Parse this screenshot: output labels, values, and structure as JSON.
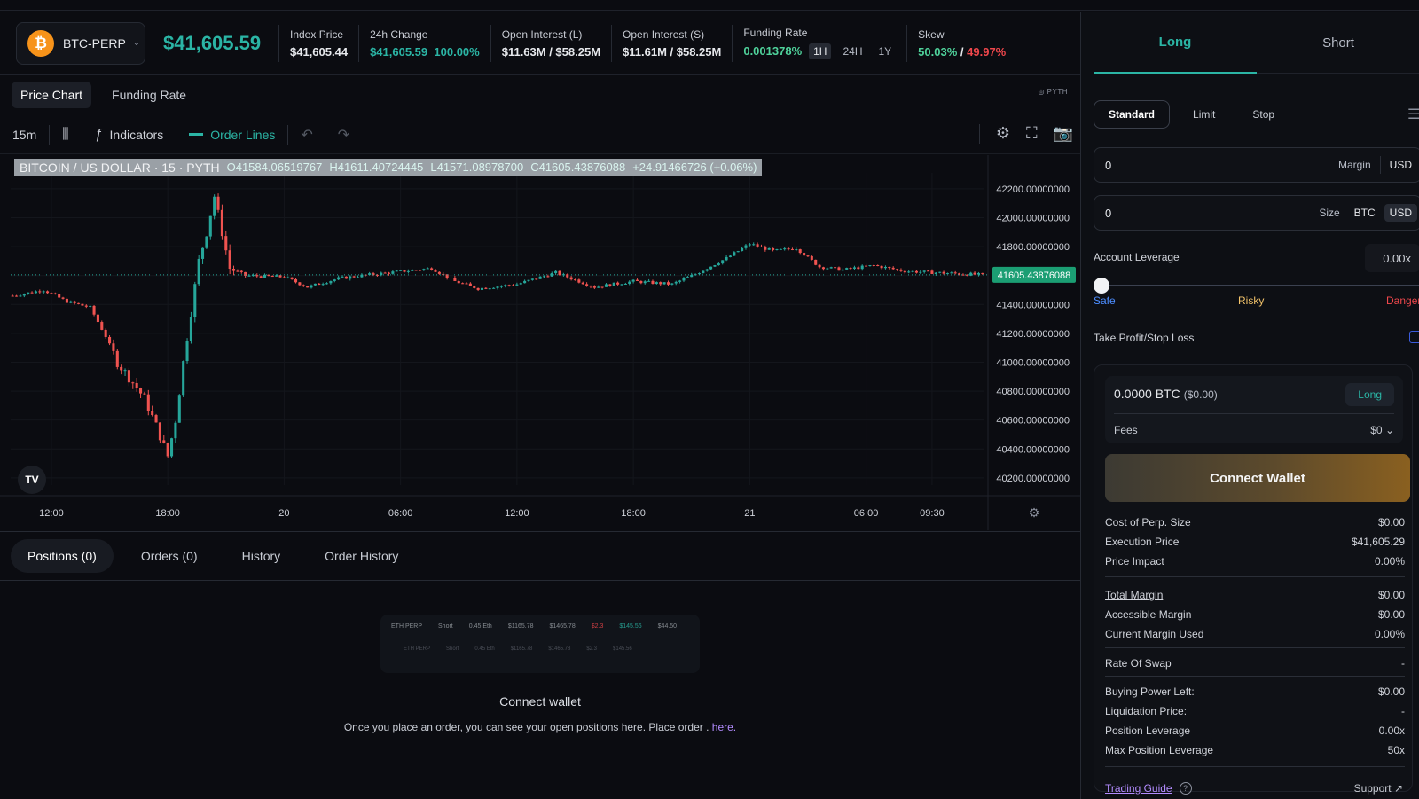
{
  "header": {
    "market": "BTC-PERP",
    "market_icon": "bitcoin-icon",
    "last_price": "$41,605.59",
    "stats": {
      "index_price_label": "Index Price",
      "index_price": "$41,605.44",
      "change_label": "24h Change",
      "change_value": "$41,605.59",
      "change_pct": "100.00%",
      "oi_long_label": "Open Interest (L)",
      "oi_long": "$11.63M / $58.25M",
      "oi_short_label": "Open Interest (S)",
      "oi_short": "$11.61M / $58.25M",
      "funding_label": "Funding Rate",
      "funding_value": "0.001378%",
      "funding_tf": [
        "1H",
        "24H",
        "1Y"
      ],
      "skew_label": "Skew",
      "skew_long": "50.03%",
      "skew_sep": "/",
      "skew_short": "49.97%"
    }
  },
  "chart_tabs": [
    "Price Chart",
    "Funding Rate"
  ],
  "toolbar": {
    "interval": "15m",
    "indicators": "Indicators",
    "order_lines": "Order Lines"
  },
  "chart_data": {
    "type": "candlestick",
    "legend_symbol": "BITCOIN / US DOLLAR · 15 · PYTH",
    "legend_o": "O41584.06519767",
    "legend_h": "H41611.40724445",
    "legend_l": "L41571.08978700",
    "legend_c": "C41605.43876088",
    "legend_chg": "+24.91466726 (+0.06%)",
    "y_ticks": [
      "42200.00000000",
      "42000.00000000",
      "41800.00000000",
      "41600.00000000",
      "41400.00000000",
      "41200.00000000",
      "41000.00000000",
      "40800.00000000",
      "40600.00000000",
      "40400.00000000",
      "40200.00000000"
    ],
    "ylim": [
      40150,
      42310
    ],
    "x_ticks": [
      "12:00",
      "18:00",
      "20",
      "06:00",
      "12:00",
      "18:00",
      "21",
      "06:00",
      "09:30"
    ],
    "last_price_label": "41605.43876088",
    "last_price": 41605.44,
    "colors": {
      "up": "#26a69a",
      "down": "#ef5350"
    },
    "close_path": [
      [
        0,
        41460
      ],
      [
        8,
        41500
      ],
      [
        14,
        41420
      ],
      [
        20,
        41380
      ],
      [
        24,
        41180
      ],
      [
        27,
        41000
      ],
      [
        31,
        40860
      ],
      [
        34,
        40750
      ],
      [
        37,
        40560
      ],
      [
        40,
        40350
      ],
      [
        42,
        40600
      ],
      [
        44,
        41000
      ],
      [
        46,
        41350
      ],
      [
        48,
        41700
      ],
      [
        50,
        41900
      ],
      [
        52,
        42150
      ],
      [
        54,
        41900
      ],
      [
        56,
        41650
      ],
      [
        60,
        41600
      ],
      [
        70,
        41590
      ],
      [
        76,
        41520
      ],
      [
        84,
        41580
      ],
      [
        90,
        41600
      ],
      [
        108,
        41650
      ],
      [
        114,
        41560
      ],
      [
        120,
        41510
      ],
      [
        130,
        41540
      ],
      [
        140,
        41620
      ],
      [
        150,
        41520
      ],
      [
        160,
        41560
      ],
      [
        170,
        41540
      ],
      [
        176,
        41610
      ],
      [
        184,
        41720
      ],
      [
        190,
        41820
      ],
      [
        196,
        41770
      ],
      [
        202,
        41790
      ],
      [
        208,
        41660
      ],
      [
        214,
        41640
      ],
      [
        222,
        41670
      ],
      [
        230,
        41630
      ],
      [
        238,
        41620
      ],
      [
        250,
        41605
      ]
    ],
    "time_ticks_at_candle": [
      10,
      40,
      70,
      100,
      130,
      160,
      190,
      220,
      237
    ]
  },
  "bottom_tabs": [
    "Positions  (0)",
    "Orders  (0)",
    "History",
    "Order History"
  ],
  "empty_state": {
    "preview_row": [
      "ETH PERP",
      "Short",
      "0.45 Eth",
      "$1165.78",
      "$1465.78",
      "$2.3",
      "$145.56",
      "$44.50"
    ],
    "preview_row2": [
      "ETH PERP",
      "Short",
      "0.45 Eth",
      "$1165.78",
      "$1465.78",
      "$2.3",
      "$145.56"
    ],
    "title": "Connect wallet",
    "subtitle": "Once you place an order, you can see your open positions here. Place order .",
    "link": "here."
  },
  "side": {
    "tabs": [
      "Long",
      "Short"
    ],
    "order_types": [
      "Standard",
      "Limit",
      "Stop"
    ],
    "margin_value": "0",
    "margin_label": "Margin",
    "margin_unit": "USD",
    "size_value": "0",
    "size_label": "Size",
    "size_units": [
      "BTC",
      "USD"
    ],
    "leverage_label": "Account Leverage",
    "leverage_value": "0.00x",
    "risk_labels": [
      "Safe",
      "Risky",
      "Danger"
    ],
    "tpsl_label": "Take Profit/Stop Loss",
    "summary_size": "0.0000 BTC",
    "summary_usd": "($0.00)",
    "summary_side": "Long",
    "fees_label": "Fees",
    "fees_value": "$0",
    "connect_button": "Connect Wallet",
    "rows1": [
      {
        "k": "Cost of Perp. Size",
        "v": "$0.00"
      },
      {
        "k": "Execution Price",
        "v": "$41,605.29"
      },
      {
        "k": "Price Impact",
        "v": "0.00%"
      }
    ],
    "rows2": [
      {
        "k": "Total Margin",
        "v": "$0.00"
      },
      {
        "k": "Accessible Margin",
        "v": "$0.00"
      },
      {
        "k": "Current Margin Used",
        "v": "0.00%"
      }
    ],
    "rows3": [
      {
        "k": "Rate Of Swap",
        "v": "-"
      }
    ],
    "rows4": [
      {
        "k": "Buying Power Left:",
        "v": "$0.00"
      },
      {
        "k": "Liquidation Price:",
        "v": "-"
      },
      {
        "k": "Position Leverage",
        "v": "0.00x"
      },
      {
        "k": "Max Position Leverage",
        "v": "50x"
      }
    ],
    "guide": "Trading Guide",
    "support": "Support"
  }
}
